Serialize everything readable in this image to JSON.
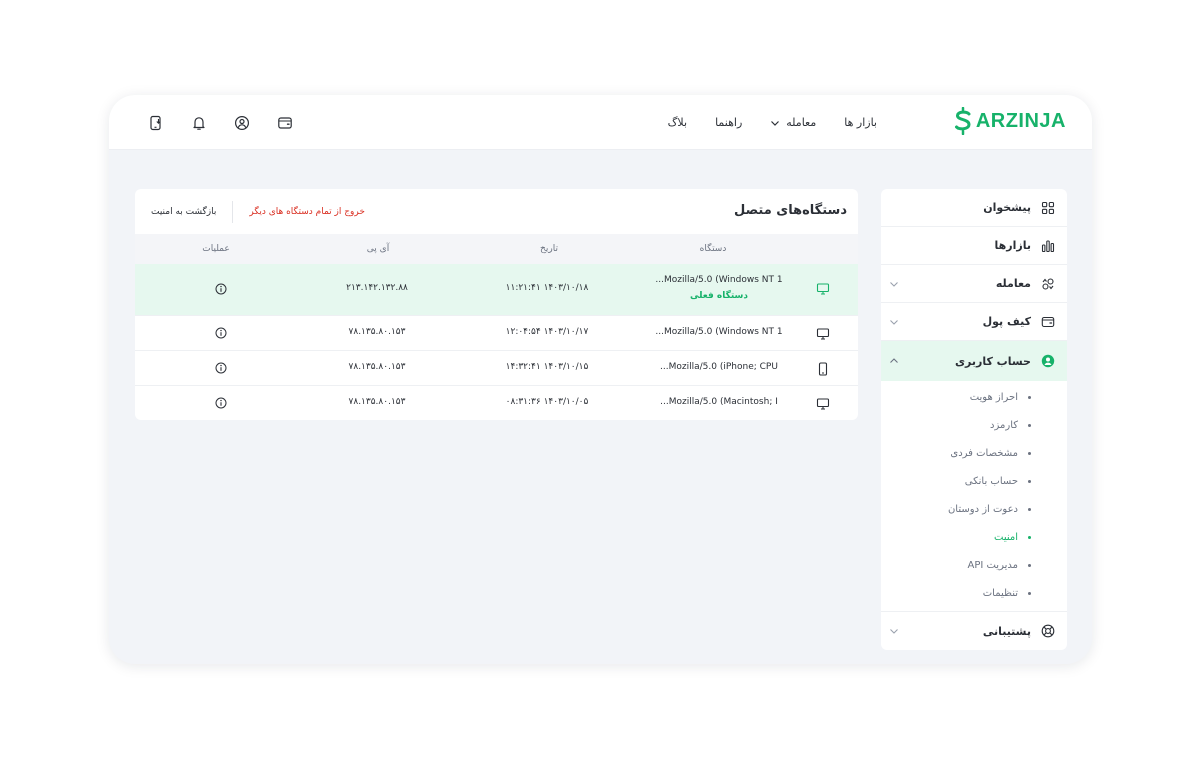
{
  "brand": {
    "name": "ARZINJA",
    "color": "#17b26a"
  },
  "nav": {
    "markets": "بازار ها",
    "trade": "معامله",
    "guide": "راهنما",
    "blog": "بلاگ"
  },
  "top_icons": [
    "download-app-icon",
    "bell-icon",
    "user-circle-icon",
    "wallet-icon"
  ],
  "sidebar": {
    "dashboard": "پیشخوان",
    "markets": "بازارها",
    "trade": "معامله",
    "wallet": "کیف پول",
    "account": "حساب کاربری",
    "account_sub": [
      "احراز هویت",
      "کارمزد",
      "مشخصات فردی",
      "حساب بانکی",
      "دعوت از دوستان",
      "امنیت",
      "مدیریت API",
      "تنظیمات"
    ],
    "support": "پشتیبانی"
  },
  "devices": {
    "title": "دستگاه‌های متصل",
    "logout_all": "خروج از تمام دستگاه های دیگر",
    "back": "بازگشت به امنیت",
    "columns": {
      "device": "دستگاه",
      "date": "تاریخ",
      "ip": "آی پی",
      "actions": "عملیات"
    },
    "current_label": "دستگاه فعلی",
    "rows": [
      {
        "device": "Mozilla/5.0 (Windows NT 1...",
        "date": "۱۴۰۳/۱۰/۱۸ ۱۱:۲۱:۴۱",
        "ip": "۲۱۳.۱۴۲.۱۳۲.۸۸",
        "type": "desktop"
      },
      {
        "device": "Mozilla/5.0 (Windows NT 1...",
        "date": "۱۴۰۳/۱۰/۱۷ ۱۲:۰۴:۵۴",
        "ip": "۷۸.۱۳۵.۸۰.۱۵۳",
        "type": "desktop"
      },
      {
        "device": "Mozilla/5.0 (iPhone; CPU...",
        "date": "۱۴۰۳/۱۰/۱۵ ۱۴:۳۲:۴۱",
        "ip": "۷۸.۱۳۵.۸۰.۱۵۳",
        "type": "mobile"
      },
      {
        "device": "Mozilla/5.0 (Macintosh; I...",
        "date": "۱۴۰۳/۱۰/۰۵ ۰۸:۳۱:۳۶",
        "ip": "۷۸.۱۳۵.۸۰.۱۵۳",
        "type": "desktop"
      }
    ]
  },
  "colors": {
    "accent": "#17b26a",
    "danger": "#d92d20",
    "current_row_bg": "#e6f8ef"
  }
}
